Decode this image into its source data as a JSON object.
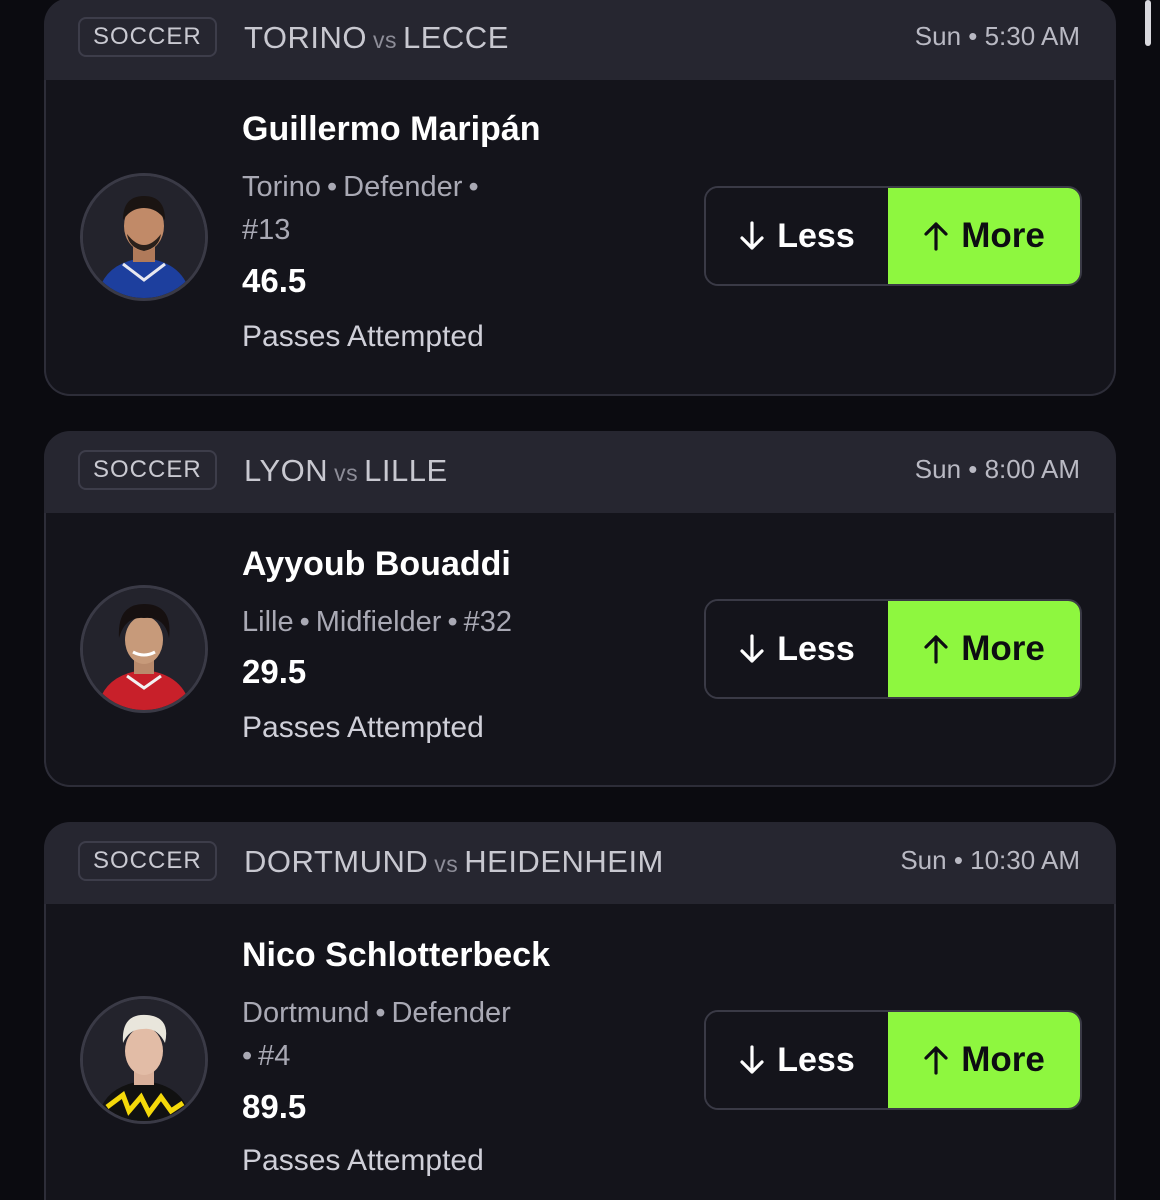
{
  "colors": {
    "more_button": "#8ef73f",
    "card_header": "#262630",
    "card_body": "#14141b",
    "background": "#0b0b10"
  },
  "cards": [
    {
      "sport": "SOCCER",
      "home_team": "TORINO",
      "vs": "vs",
      "away_team": "LECCE",
      "time": "Sun • 5:30 AM",
      "player_name": "Guillermo Maripán",
      "team": "Torino",
      "position": "Defender",
      "number": "#13",
      "line": "46.5",
      "stat": "Passes Attempted",
      "less_label": "Less",
      "more_label": "More",
      "less_icon": "arrow-down-icon",
      "more_icon": "arrow-up-icon",
      "more_selected": true
    },
    {
      "sport": "SOCCER",
      "home_team": "LYON",
      "vs": "vs",
      "away_team": "LILLE",
      "time": "Sun • 8:00 AM",
      "player_name": "Ayyoub Bouaddi",
      "team": "Lille",
      "position": "Midfielder",
      "number": "#32",
      "line": "29.5",
      "stat": "Passes Attempted",
      "less_label": "Less",
      "more_label": "More",
      "less_icon": "arrow-down-icon",
      "more_icon": "arrow-up-icon",
      "more_selected": true
    },
    {
      "sport": "SOCCER",
      "home_team": "DORTMUND",
      "vs": "vs",
      "away_team": "HEIDENHEIM",
      "time": "Sun • 10:30 AM",
      "player_name": "Nico Schlotterbeck",
      "team": "Dortmund",
      "position": "Defender",
      "number": "#4",
      "line": "89.5",
      "stat": "Passes Attempted",
      "less_label": "Less",
      "more_label": "More",
      "less_icon": "arrow-down-icon",
      "more_icon": "arrow-up-icon",
      "more_selected": true
    }
  ]
}
